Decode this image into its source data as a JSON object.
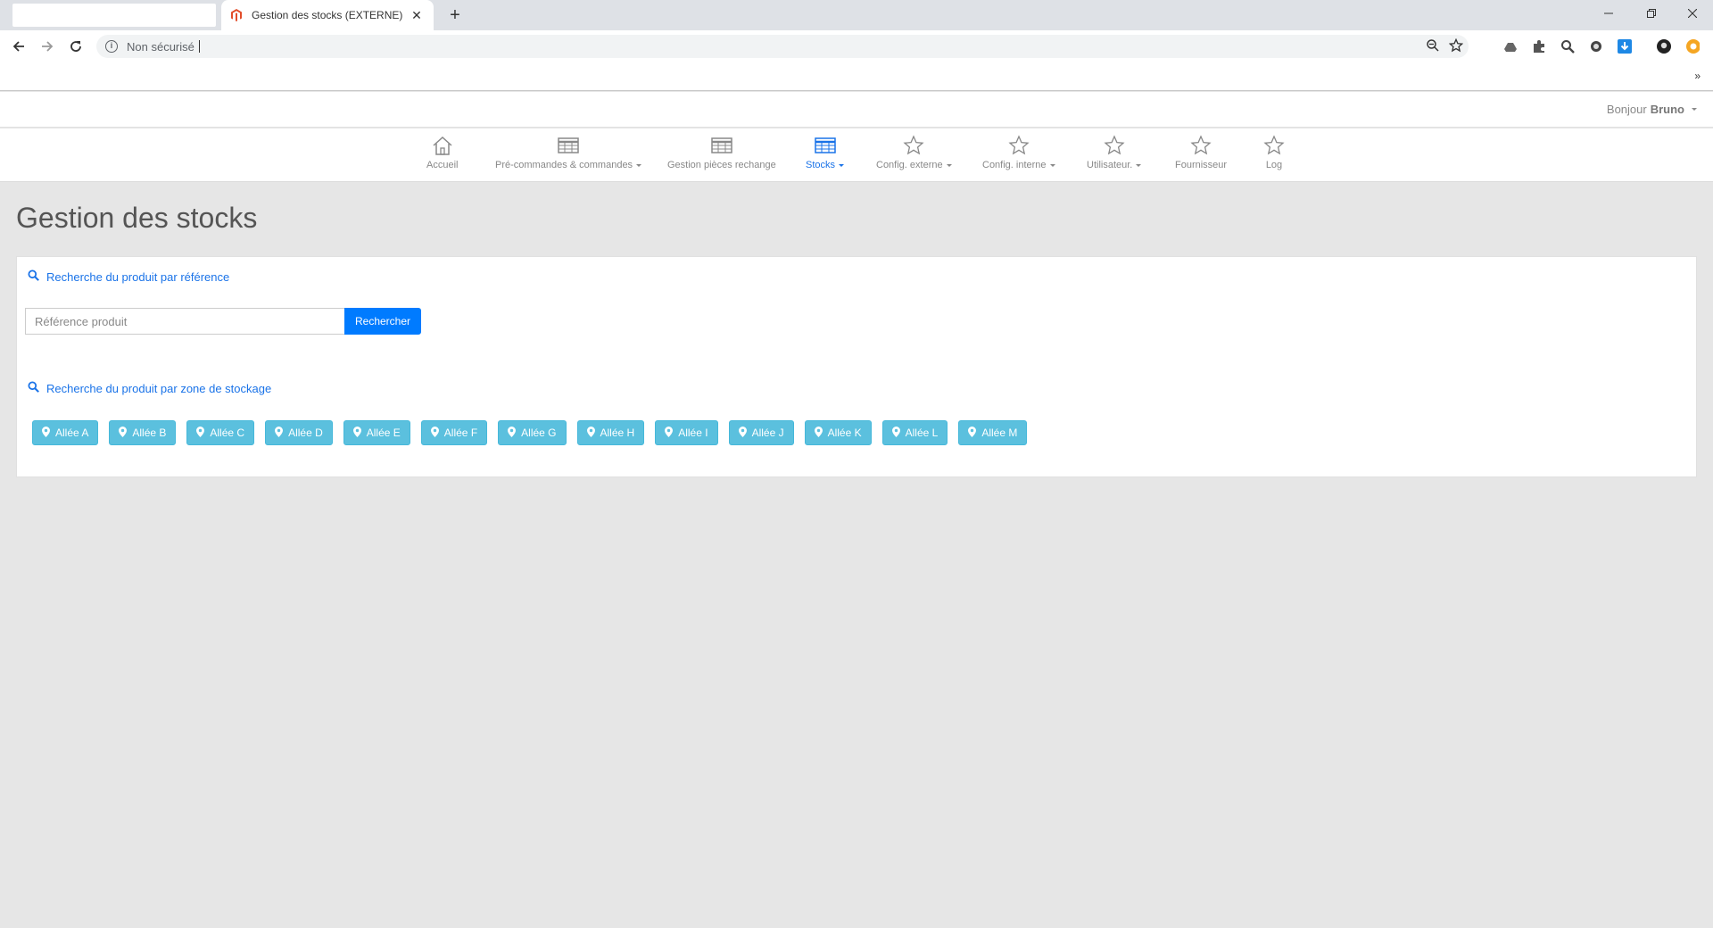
{
  "browser": {
    "tab_title": "Gestion des stocks (EXTERNE)",
    "new_tab": "+",
    "omnibox_text": "Non sécurisé",
    "bookmarks_more": "»"
  },
  "header": {
    "greeting_prefix": "Bonjour",
    "user_name": "Bruno"
  },
  "nav": {
    "items": [
      {
        "label": "Accueil",
        "icon": "home-icon"
      },
      {
        "label": "Pré-commandes & commandes",
        "icon": "table-icon"
      },
      {
        "label": "Gestion pièces rechange",
        "icon": "table-icon"
      },
      {
        "label": "Stocks",
        "icon": "table-icon"
      },
      {
        "label": "Config. externe",
        "icon": "star-icon"
      },
      {
        "label": "Config. interne",
        "icon": "star-icon"
      },
      {
        "label": "Utilisateur.",
        "icon": "star-icon"
      },
      {
        "label": "Fournisseur",
        "icon": "star-icon"
      },
      {
        "label": "Log",
        "icon": "star-icon"
      }
    ]
  },
  "page": {
    "title": "Gestion des stocks"
  },
  "search_ref": {
    "heading": "Recherche du produit par référence",
    "placeholder": "Référence produit",
    "button": "Rechercher"
  },
  "search_zone": {
    "heading": "Recherche du produit par zone de stockage",
    "aisles": [
      "Allée A",
      "Allée B",
      "Allée C",
      "Allée D",
      "Allée E",
      "Allée F",
      "Allée G",
      "Allée H",
      "Allée I",
      "Allée J",
      "Allée K",
      "Allée L",
      "Allée M"
    ]
  },
  "colors": {
    "primary": "#007bff",
    "info": "#5bc0de",
    "link": "#1a73e8",
    "background": "#e6e6e6"
  }
}
